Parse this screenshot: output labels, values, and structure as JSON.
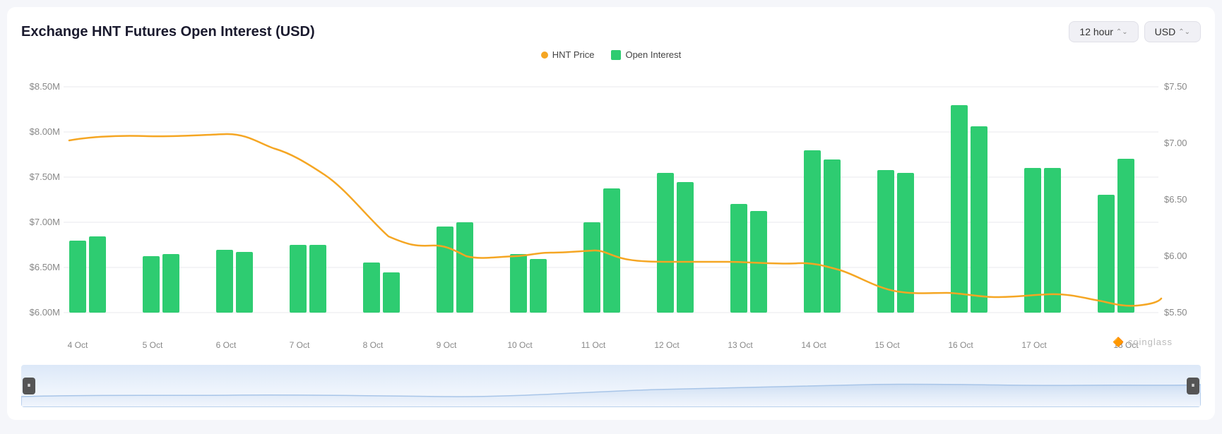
{
  "title": "Exchange HNT Futures Open Interest (USD)",
  "controls": {
    "interval": "12 hour",
    "currency": "USD"
  },
  "legend": {
    "price_label": "HNT Price",
    "oi_label": "Open Interest"
  },
  "yAxis": {
    "left": [
      "$8.50M",
      "$8.00M",
      "$7.50M",
      "$7.00M",
      "$6.50M",
      "$6.00M"
    ],
    "right": [
      "$7.50",
      "$7.00",
      "$6.50",
      "$6.00",
      "$5.50"
    ]
  },
  "xAxis": [
    "4 Oct",
    "5 Oct",
    "6 Oct",
    "7 Oct",
    "8 Oct",
    "9 Oct",
    "10 Oct",
    "11 Oct",
    "12 Oct",
    "13 Oct",
    "14 Oct",
    "15 Oct",
    "16 Oct",
    "17 Oct",
    "18 Oct"
  ],
  "bars": [
    {
      "label": "4 Oct",
      "height_pct": 32
    },
    {
      "label": "4 Oct b",
      "height_pct": 34
    },
    {
      "label": "5 Oct",
      "height_pct": 25
    },
    {
      "label": "5 Oct b",
      "height_pct": 26
    },
    {
      "label": "6 Oct",
      "height_pct": 28
    },
    {
      "label": "6 Oct b",
      "height_pct": 27
    },
    {
      "label": "7 Oct",
      "height_pct": 30
    },
    {
      "label": "7 Oct b",
      "height_pct": 30
    },
    {
      "label": "8 Oct",
      "height_pct": 22
    },
    {
      "label": "8 Oct b",
      "height_pct": 18
    },
    {
      "label": "9 Oct",
      "height_pct": 38
    },
    {
      "label": "9 Oct b",
      "height_pct": 40
    },
    {
      "label": "10 Oct",
      "height_pct": 26
    },
    {
      "label": "10 Oct b",
      "height_pct": 24
    },
    {
      "label": "11 Oct",
      "height_pct": 40
    },
    {
      "label": "11 Oct b",
      "height_pct": 55
    },
    {
      "label": "12 Oct",
      "height_pct": 62
    },
    {
      "label": "12 Oct b",
      "height_pct": 58
    },
    {
      "label": "13 Oct",
      "height_pct": 48
    },
    {
      "label": "13 Oct b",
      "height_pct": 45
    },
    {
      "label": "14 Oct",
      "height_pct": 72
    },
    {
      "label": "14 Oct b",
      "height_pct": 68
    },
    {
      "label": "15 Oct",
      "height_pct": 63
    },
    {
      "label": "15 Oct b",
      "height_pct": 62
    },
    {
      "label": "16 Oct",
      "height_pct": 92
    },
    {
      "label": "16 Oct b",
      "height_pct": 80
    },
    {
      "label": "17 Oct",
      "height_pct": 64
    },
    {
      "label": "17 Oct b",
      "height_pct": 64
    },
    {
      "label": "18 Oct",
      "height_pct": 52
    },
    {
      "label": "18 Oct b",
      "height_pct": 68
    }
  ],
  "watermark": "coinglass",
  "handle_icon": "⏸"
}
